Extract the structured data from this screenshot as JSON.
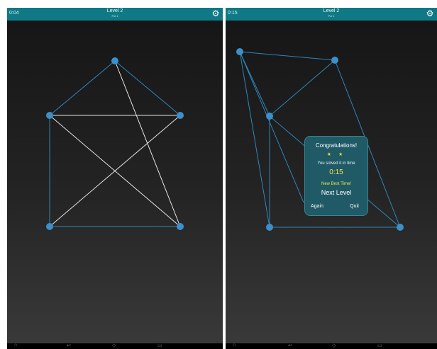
{
  "left_screen": {
    "timer": "0:04",
    "level_title": "Level 2",
    "pack_label": "Pst 1",
    "icons": {
      "settings": "gear-icon"
    },
    "nav_icons": [
      "home-icon",
      "back-icon",
      "home-outline-icon",
      "recents-icon"
    ]
  },
  "right_screen": {
    "timer": "0:15",
    "level_title": "Level 2",
    "pack_label": "Pst 1",
    "icons": {
      "settings": "gear-icon"
    },
    "nav_icons": [
      "home-icon",
      "back-icon",
      "home-outline-icon",
      "recents-icon"
    ],
    "dialog": {
      "title": "Congratulations!",
      "stars": "★ ★",
      "solved_text": "You solved it in time",
      "time": "0:15",
      "best_time": "New Best Time!",
      "next_label": "Next Level",
      "again_label": "Again",
      "quit_label": "Quit"
    }
  },
  "colors": {
    "topbar": "#0f7a86",
    "node": "#3c8fc9",
    "edge_blue": "#2f86b8",
    "edge_crossing": "#e6e6e6",
    "dialog_bg": "#1f5a66",
    "star": "#f5d13a"
  }
}
